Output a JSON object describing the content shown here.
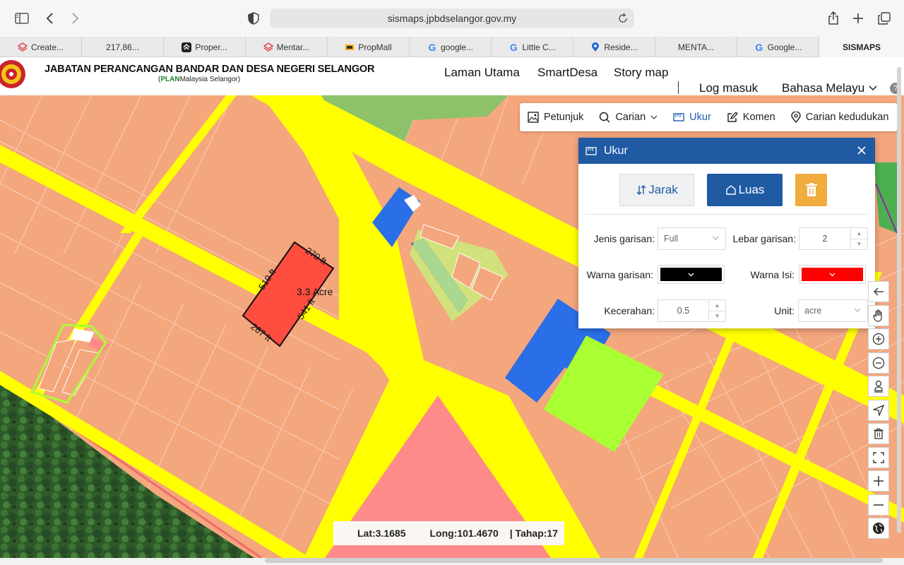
{
  "browser": {
    "url": "sismaps.jpbdselangor.gov.my",
    "tabs": [
      {
        "label": "Create..."
      },
      {
        "label": "217,86..."
      },
      {
        "label": "Proper..."
      },
      {
        "label": "Mentar..."
      },
      {
        "label": "PropMall"
      },
      {
        "label": "google..."
      },
      {
        "label": "Little C..."
      },
      {
        "label": "Reside..."
      },
      {
        "label": "MENTA..."
      },
      {
        "label": "Google..."
      },
      {
        "label": "SISMAPS"
      }
    ]
  },
  "header": {
    "org_title": "JABATAN PERANCANGAN BANDAR DAN DESA NEGERI SELANGOR",
    "org_sub_prefix": "(",
    "org_sub_plan": "PLAN",
    "org_sub_rest": "Malaysia Selangor)",
    "nav": [
      "Laman Utama",
      "SmartDesa",
      "Story map"
    ],
    "login": "Log masuk",
    "language": "Bahasa Melayu",
    "help": "?"
  },
  "map_tools": {
    "petunjuk": "Petunjuk",
    "carian": "Carian",
    "ukur": "Ukur",
    "komen": "Komen",
    "carian_kedudukan": "Carian kedudukan"
  },
  "ukur_panel": {
    "title": "Ukur",
    "jarak": "Jarak",
    "luas": "Luas",
    "jenis_label": "Jenis garisan:",
    "jenis_value": "Full",
    "lebar_label": "Lebar garisan:",
    "lebar_value": "2",
    "warna_garisan_label": "Warna garisan:",
    "warna_garisan_color": "#000000",
    "warna_isi_label": "Warna Isi:",
    "warna_isi_color": "#ff0000",
    "kecerahan_label": "Kecerahan:",
    "kecerahan_value": "0.5",
    "unit_label": "Unit:",
    "unit_value": "acre"
  },
  "measurement": {
    "area": "3.3 Acre",
    "side_top": "270 ft",
    "side_left": "519 ft",
    "side_right": "541 ft",
    "side_bottom": "267 ft"
  },
  "status": {
    "lat": "Lat:3.1685",
    "long": "Long:101.4670",
    "tahap": "| Tahap:17"
  },
  "colors": {
    "residential": "#f4a67d",
    "road": "#ffff00",
    "agriculture": "#8dc26b",
    "commercial": "#ff8a8a",
    "institution": "#2a6ee8",
    "open_space": "#aaff33",
    "measure_fill": "#ff4d40",
    "accent": "#1f5aa3"
  }
}
